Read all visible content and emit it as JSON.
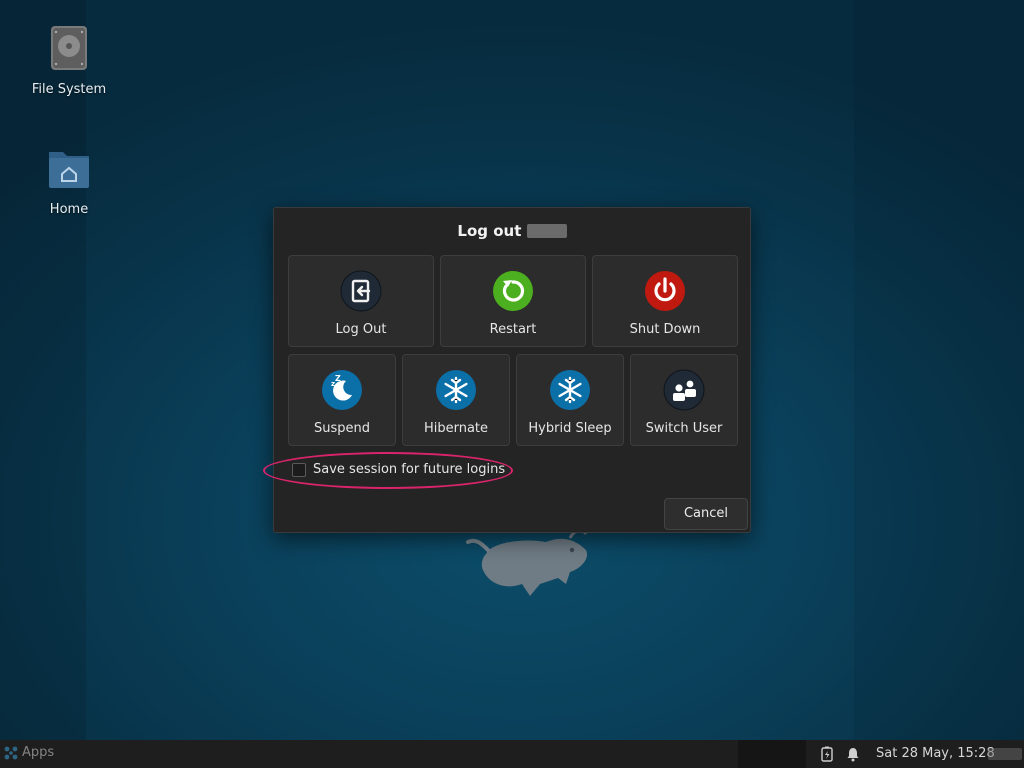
{
  "desktop": {
    "icons": [
      {
        "label": "File System",
        "icon": "drive-icon"
      },
      {
        "label": "Home",
        "icon": "home-folder-icon"
      }
    ]
  },
  "dialog": {
    "title": "Log out",
    "actions": [
      {
        "label": "Log Out",
        "icon": "log-out-icon",
        "color": "#1f2a36"
      },
      {
        "label": "Restart",
        "icon": "restart-icon",
        "color": "#4caf1f"
      },
      {
        "label": "Shut Down",
        "icon": "power-icon",
        "color": "#c0190f"
      },
      {
        "label": "Suspend",
        "icon": "suspend-moon-icon",
        "color": "#0b6fa8"
      },
      {
        "label": "Hibernate",
        "icon": "snowflake-icon",
        "color": "#0b6fa8"
      },
      {
        "label": "Hybrid Sleep",
        "icon": "snowflake-icon",
        "color": "#0b6fa8"
      },
      {
        "label": "Switch User",
        "icon": "switch-user-icon",
        "color": "#1f2a36"
      }
    ],
    "save_session_label": "Save session for future logins",
    "save_session_checked": false,
    "cancel_label": "Cancel",
    "highlight_color": "#d9246b"
  },
  "taskbar": {
    "apps_label": "Apps",
    "clock": "Sat 28 May, 15:28"
  }
}
